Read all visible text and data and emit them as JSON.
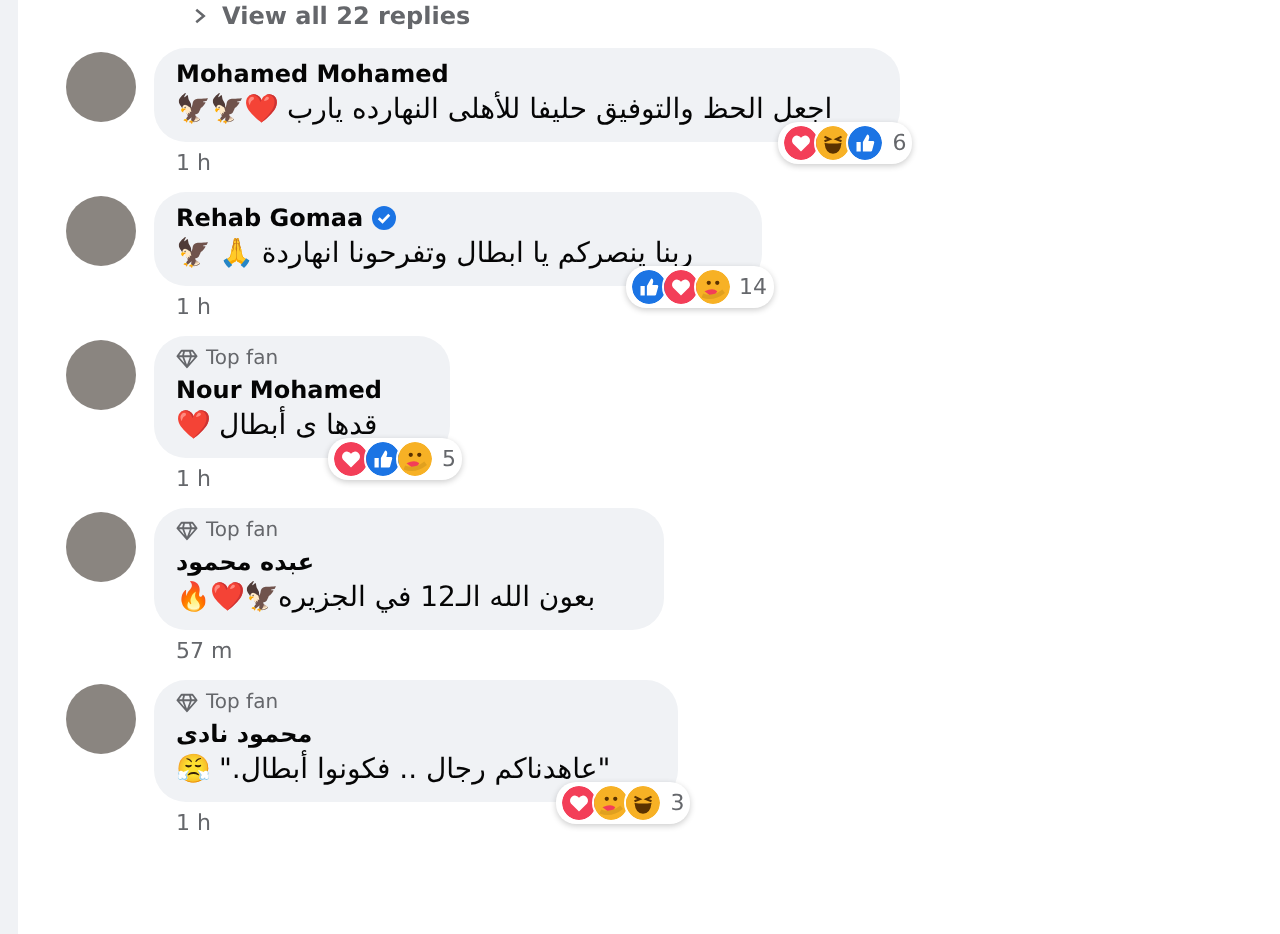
{
  "view_replies": "View all 22 replies",
  "comments": [
    {
      "name": "Mohamed Mohamed",
      "verified": false,
      "text": "اجعل الحظ والتوفيق حليفا للأهلى النهارده يارب ❤️🦅🦅",
      "reactions": [
        {
          "kind": "love"
        },
        {
          "kind": "haha"
        },
        {
          "kind": "like"
        }
      ],
      "count": "6",
      "time": "1 h"
    },
    {
      "name": "Rehab Gomaa",
      "verified": true,
      "text": "ربنا ينصركم يا ابطال وتفرحونا انهاردة 🙏 🦅",
      "reactions": [
        {
          "kind": "like"
        },
        {
          "kind": "love"
        },
        {
          "kind": "care"
        }
      ],
      "count": "14",
      "time": "1 h"
    },
    {
      "top_fan_label": "Top fan",
      "name": "Nour Mohamed",
      "verified": false,
      "text": "قدها ى أبطال ❤️",
      "reactions": [
        {
          "kind": "love"
        },
        {
          "kind": "like"
        },
        {
          "kind": "care"
        }
      ],
      "count": "5",
      "time": "1 h"
    },
    {
      "top_fan_label": "Top fan",
      "name": "عبده محمود",
      "verified": false,
      "text": "بعون الله الـ12 في الجزيره🦅❤️🔥",
      "time": "57 m"
    },
    {
      "top_fan_label": "Top fan",
      "name": "محمود نادى",
      "verified": false,
      "text": "\"عاهدناكم رجال .. فكونوا أبطال.\" 😤",
      "reactions": [
        {
          "kind": "love"
        },
        {
          "kind": "care"
        },
        {
          "kind": "haha"
        }
      ],
      "count": "3",
      "time": "1 h"
    }
  ]
}
